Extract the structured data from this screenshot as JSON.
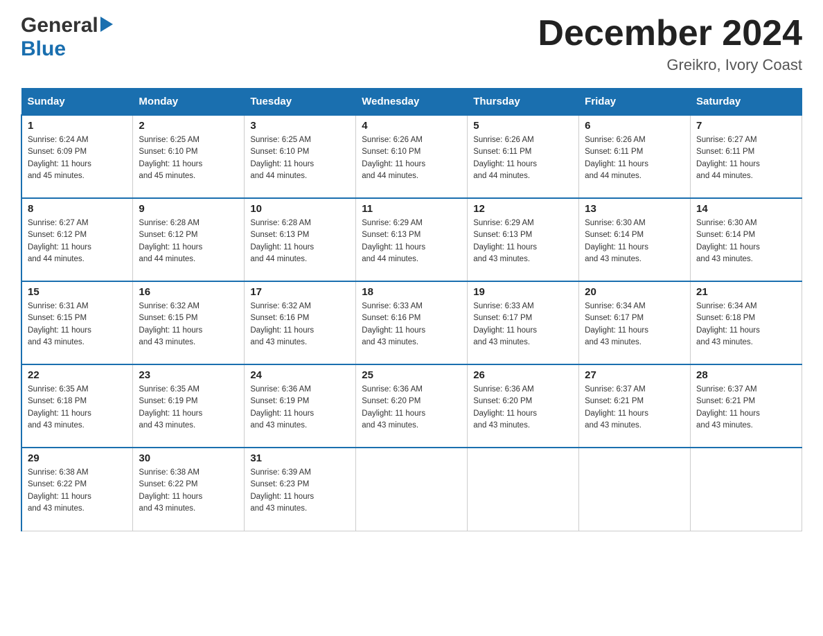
{
  "header": {
    "logo_general": "General",
    "logo_blue": "Blue",
    "month_title": "December 2024",
    "location": "Greikro, Ivory Coast"
  },
  "days_of_week": [
    "Sunday",
    "Monday",
    "Tuesday",
    "Wednesday",
    "Thursday",
    "Friday",
    "Saturday"
  ],
  "weeks": [
    [
      {
        "day": "1",
        "sunrise": "6:24 AM",
        "sunset": "6:09 PM",
        "daylight": "11 hours and 45 minutes."
      },
      {
        "day": "2",
        "sunrise": "6:25 AM",
        "sunset": "6:10 PM",
        "daylight": "11 hours and 45 minutes."
      },
      {
        "day": "3",
        "sunrise": "6:25 AM",
        "sunset": "6:10 PM",
        "daylight": "11 hours and 44 minutes."
      },
      {
        "day": "4",
        "sunrise": "6:26 AM",
        "sunset": "6:10 PM",
        "daylight": "11 hours and 44 minutes."
      },
      {
        "day": "5",
        "sunrise": "6:26 AM",
        "sunset": "6:11 PM",
        "daylight": "11 hours and 44 minutes."
      },
      {
        "day": "6",
        "sunrise": "6:26 AM",
        "sunset": "6:11 PM",
        "daylight": "11 hours and 44 minutes."
      },
      {
        "day": "7",
        "sunrise": "6:27 AM",
        "sunset": "6:11 PM",
        "daylight": "11 hours and 44 minutes."
      }
    ],
    [
      {
        "day": "8",
        "sunrise": "6:27 AM",
        "sunset": "6:12 PM",
        "daylight": "11 hours and 44 minutes."
      },
      {
        "day": "9",
        "sunrise": "6:28 AM",
        "sunset": "6:12 PM",
        "daylight": "11 hours and 44 minutes."
      },
      {
        "day": "10",
        "sunrise": "6:28 AM",
        "sunset": "6:13 PM",
        "daylight": "11 hours and 44 minutes."
      },
      {
        "day": "11",
        "sunrise": "6:29 AM",
        "sunset": "6:13 PM",
        "daylight": "11 hours and 44 minutes."
      },
      {
        "day": "12",
        "sunrise": "6:29 AM",
        "sunset": "6:13 PM",
        "daylight": "11 hours and 43 minutes."
      },
      {
        "day": "13",
        "sunrise": "6:30 AM",
        "sunset": "6:14 PM",
        "daylight": "11 hours and 43 minutes."
      },
      {
        "day": "14",
        "sunrise": "6:30 AM",
        "sunset": "6:14 PM",
        "daylight": "11 hours and 43 minutes."
      }
    ],
    [
      {
        "day": "15",
        "sunrise": "6:31 AM",
        "sunset": "6:15 PM",
        "daylight": "11 hours and 43 minutes."
      },
      {
        "day": "16",
        "sunrise": "6:32 AM",
        "sunset": "6:15 PM",
        "daylight": "11 hours and 43 minutes."
      },
      {
        "day": "17",
        "sunrise": "6:32 AM",
        "sunset": "6:16 PM",
        "daylight": "11 hours and 43 minutes."
      },
      {
        "day": "18",
        "sunrise": "6:33 AM",
        "sunset": "6:16 PM",
        "daylight": "11 hours and 43 minutes."
      },
      {
        "day": "19",
        "sunrise": "6:33 AM",
        "sunset": "6:17 PM",
        "daylight": "11 hours and 43 minutes."
      },
      {
        "day": "20",
        "sunrise": "6:34 AM",
        "sunset": "6:17 PM",
        "daylight": "11 hours and 43 minutes."
      },
      {
        "day": "21",
        "sunrise": "6:34 AM",
        "sunset": "6:18 PM",
        "daylight": "11 hours and 43 minutes."
      }
    ],
    [
      {
        "day": "22",
        "sunrise": "6:35 AM",
        "sunset": "6:18 PM",
        "daylight": "11 hours and 43 minutes."
      },
      {
        "day": "23",
        "sunrise": "6:35 AM",
        "sunset": "6:19 PM",
        "daylight": "11 hours and 43 minutes."
      },
      {
        "day": "24",
        "sunrise": "6:36 AM",
        "sunset": "6:19 PM",
        "daylight": "11 hours and 43 minutes."
      },
      {
        "day": "25",
        "sunrise": "6:36 AM",
        "sunset": "6:20 PM",
        "daylight": "11 hours and 43 minutes."
      },
      {
        "day": "26",
        "sunrise": "6:36 AM",
        "sunset": "6:20 PM",
        "daylight": "11 hours and 43 minutes."
      },
      {
        "day": "27",
        "sunrise": "6:37 AM",
        "sunset": "6:21 PM",
        "daylight": "11 hours and 43 minutes."
      },
      {
        "day": "28",
        "sunrise": "6:37 AM",
        "sunset": "6:21 PM",
        "daylight": "11 hours and 43 minutes."
      }
    ],
    [
      {
        "day": "29",
        "sunrise": "6:38 AM",
        "sunset": "6:22 PM",
        "daylight": "11 hours and 43 minutes."
      },
      {
        "day": "30",
        "sunrise": "6:38 AM",
        "sunset": "6:22 PM",
        "daylight": "11 hours and 43 minutes."
      },
      {
        "day": "31",
        "sunrise": "6:39 AM",
        "sunset": "6:23 PM",
        "daylight": "11 hours and 43 minutes."
      },
      null,
      null,
      null,
      null
    ]
  ],
  "labels": {
    "sunrise": "Sunrise:",
    "sunset": "Sunset:",
    "daylight": "Daylight:"
  }
}
